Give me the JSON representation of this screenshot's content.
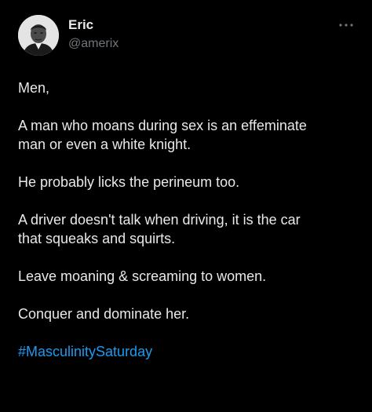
{
  "author": {
    "display_name": "Eric",
    "handle": "@amerix",
    "avatar_icon": "profile-photo"
  },
  "more_icon": "more-horizontal-icon",
  "post": {
    "paragraphs": [
      {
        "lines": [
          "Men,"
        ]
      },
      {
        "lines": [
          "A man who moans during sex is an effeminate",
          "man or even a white knight."
        ]
      },
      {
        "lines": [
          "He probably licks the perineum too."
        ]
      },
      {
        "lines": [
          "A driver doesn't talk when driving, it is the car",
          "that squeaks and squirts."
        ]
      },
      {
        "lines": [
          "Leave moaning & screaming to women."
        ]
      },
      {
        "lines": [
          "Conquer and dominate her."
        ]
      }
    ],
    "hashtag": "#MasculinitySaturday"
  },
  "colors": {
    "background": "#000000",
    "text": "#e7e9ea",
    "muted": "#71767b",
    "link": "#1d9bf0"
  }
}
